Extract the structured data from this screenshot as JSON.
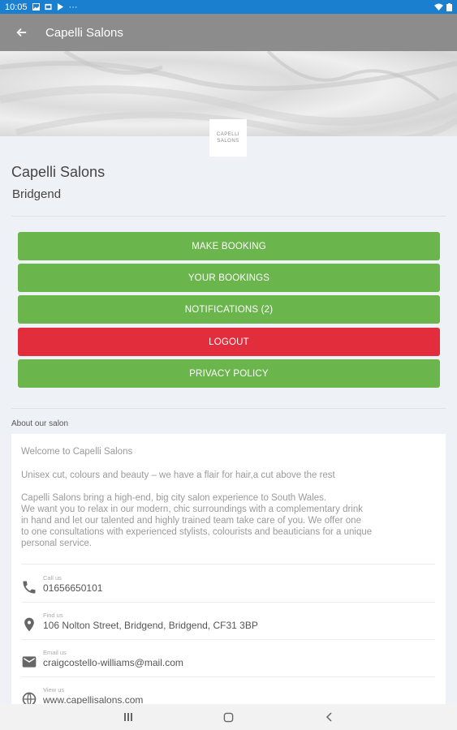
{
  "status_bar": {
    "time": "10:05"
  },
  "app_bar": {
    "title": "Capelli Salons"
  },
  "logo": {
    "line1": "CAPELLI",
    "line2": "SALONS"
  },
  "salon": {
    "name": "Capelli Salons",
    "location": "Bridgend"
  },
  "buttons": [
    {
      "label": "MAKE BOOKING",
      "color": "#6ab54c"
    },
    {
      "label": "YOUR BOOKINGS",
      "color": "#6ab54c"
    },
    {
      "label": "NOTIFICATIONS (2)",
      "color": "#6ab54c"
    },
    {
      "label": "LOGOUT",
      "color": "#e22d3d"
    },
    {
      "label": "PRIVACY POLICY",
      "color": "#6ab54c"
    }
  ],
  "about": {
    "heading": "About our salon",
    "welcome": "Welcome to Capelli Salons",
    "tagline": "Unisex cut, colours and beauty – we have a flair for hair,a cut above the rest",
    "description_lines": [
      "Capelli Salons bring a high-end, big city salon experience to South Wales.",
      "We want you to relax in our modern, chic surroundings with a complementary drink",
      "in hand and let our talented and highly trained team take care of you. We offer one",
      "to one consultations with experienced stylists, colourists and beauticians for a unique",
      "personal service."
    ]
  },
  "contacts": {
    "phone": {
      "label": "Call us",
      "value": "01656650101",
      "icon": "phone-icon"
    },
    "address": {
      "label": "Find us",
      "value": "106 Nolton Street, Bridgend, Bridgend, CF31 3BP",
      "icon": "location-icon"
    },
    "email": {
      "label": "Email us",
      "value": "craigcostello-williams@mail.com",
      "icon": "email-icon"
    },
    "web": {
      "label": "View us",
      "value": "www.capellisalons.com",
      "icon": "globe-icon"
    }
  }
}
